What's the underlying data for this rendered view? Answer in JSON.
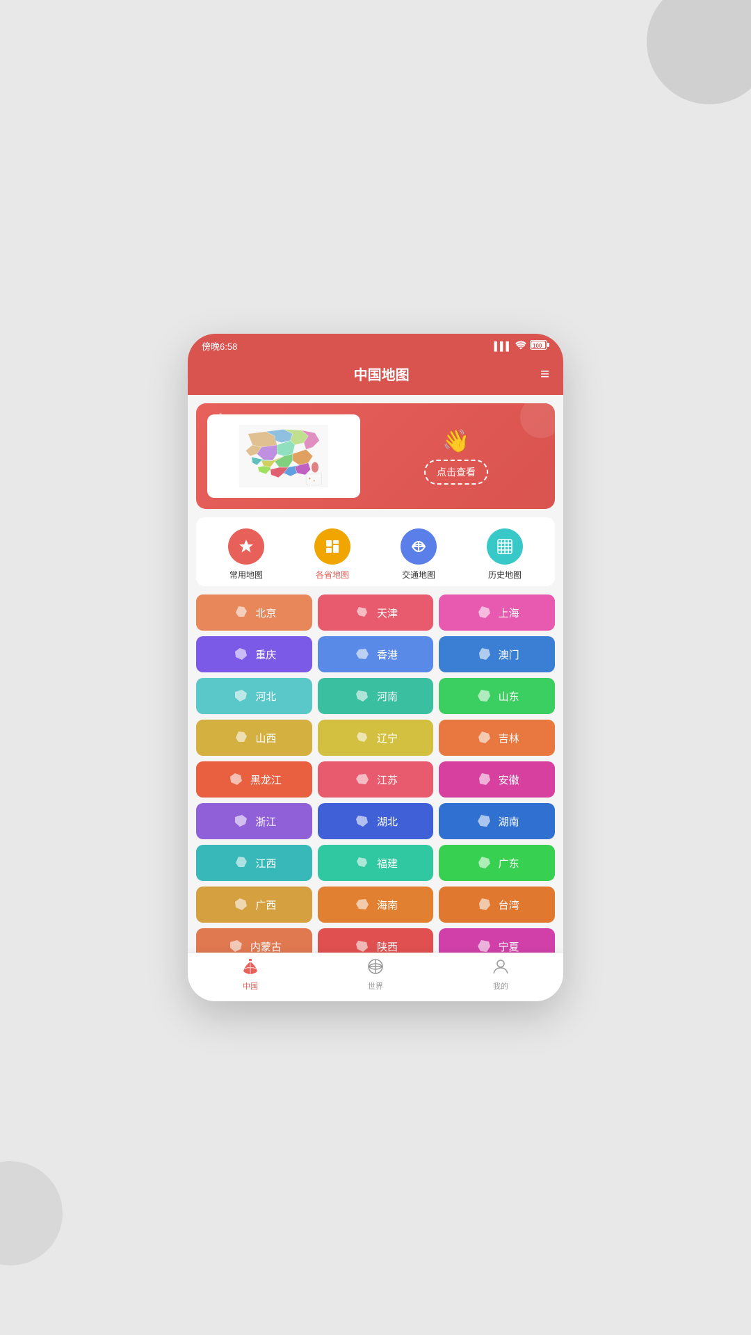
{
  "status_bar": {
    "time": "傍晚6:58",
    "signal": "▌▌▌",
    "wifi": "WiFi",
    "battery": "100"
  },
  "header": {
    "title": "中国地图",
    "menu_label": "≡"
  },
  "banner": {
    "click_label": "点击查看"
  },
  "categories": [
    {
      "id": "common",
      "label": "常用地图",
      "color": "#e8605a",
      "active": false
    },
    {
      "id": "province",
      "label": "各省地图",
      "color": "#f0a500",
      "active": true
    },
    {
      "id": "transport",
      "label": "交通地图",
      "color": "#5a7fe8",
      "active": false
    },
    {
      "id": "history",
      "label": "历史地图",
      "color": "#38c8c8",
      "active": false
    }
  ],
  "provinces": [
    {
      "name": "北京",
      "color": "#e8875a"
    },
    {
      "name": "天津",
      "color": "#e85a6e"
    },
    {
      "name": "上海",
      "color": "#e85ab0"
    },
    {
      "name": "重庆",
      "color": "#7c5ae8"
    },
    {
      "name": "香港",
      "color": "#5a8ae8"
    },
    {
      "name": "澳门",
      "color": "#3a7fd4"
    },
    {
      "name": "河北",
      "color": "#5ac8c8"
    },
    {
      "name": "河南",
      "color": "#3abfa0"
    },
    {
      "name": "山东",
      "color": "#3acf60"
    },
    {
      "name": "山西",
      "color": "#d4b040"
    },
    {
      "name": "辽宁",
      "color": "#d4c040"
    },
    {
      "name": "吉林",
      "color": "#e87840"
    },
    {
      "name": "黑龙江",
      "color": "#e86040"
    },
    {
      "name": "江苏",
      "color": "#e85a6e"
    },
    {
      "name": "安徽",
      "color": "#d840a0"
    },
    {
      "name": "浙江",
      "color": "#9060d8"
    },
    {
      "name": "湖北",
      "color": "#4060d8"
    },
    {
      "name": "湖南",
      "color": "#3070d0"
    },
    {
      "name": "江西",
      "color": "#38b8b8"
    },
    {
      "name": "福建",
      "color": "#30c8a0"
    },
    {
      "name": "广东",
      "color": "#38d050"
    },
    {
      "name": "广西",
      "color": "#d4a040"
    },
    {
      "name": "海南",
      "color": "#e08030"
    },
    {
      "name": "台湾",
      "color": "#e07830"
    },
    {
      "name": "内蒙古",
      "color": "#e07850"
    },
    {
      "name": "陕西",
      "color": "#e05050"
    },
    {
      "name": "宁夏",
      "color": "#d040a8"
    }
  ],
  "bottom_nav": [
    {
      "id": "china",
      "label": "中国",
      "active": true
    },
    {
      "id": "world",
      "label": "世界",
      "active": false
    },
    {
      "id": "mine",
      "label": "我的",
      "active": false
    }
  ]
}
